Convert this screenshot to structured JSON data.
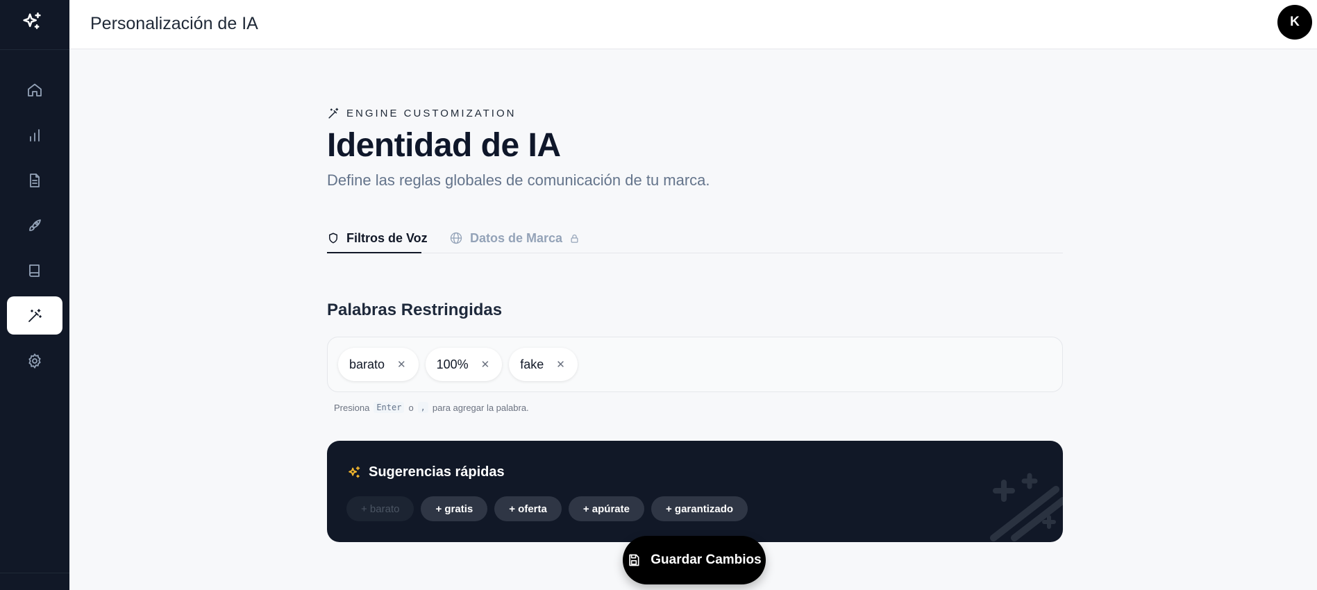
{
  "header": {
    "title": "Personalización de IA",
    "avatar_initial": "K"
  },
  "sidebar": {
    "items": [
      {
        "icon": "home-icon"
      },
      {
        "icon": "bar-chart-icon"
      },
      {
        "icon": "document-icon"
      },
      {
        "icon": "rocket-icon"
      },
      {
        "icon": "book-icon"
      },
      {
        "icon": "magic-wand-icon",
        "active": true
      },
      {
        "icon": "gear-icon"
      }
    ]
  },
  "main": {
    "eyebrow": "ENGINE CUSTOMIZATION",
    "title": "Identidad de IA",
    "subtitle": "Define las reglas globales de comunicación de tu marca.",
    "tabs": [
      {
        "label": "Filtros de Voz",
        "active": true
      },
      {
        "label": "Datos de Marca",
        "locked": true
      }
    ],
    "restricted": {
      "title": "Palabras Restringidas",
      "tags": [
        "barato",
        "100%",
        "fake"
      ],
      "hint_prefix": "Presiona",
      "hint_key1": "Enter",
      "hint_or": "o",
      "hint_key2": ",",
      "hint_suffix": "para agregar la palabra."
    },
    "suggestions": {
      "title": "Sugerencias rápidas",
      "chips": [
        {
          "label": "+ barato",
          "disabled": true
        },
        {
          "label": "+ gratis"
        },
        {
          "label": "+ oferta"
        },
        {
          "label": "+ apúrate"
        },
        {
          "label": "+ garantizado"
        }
      ]
    },
    "save_label": "Guardar Cambios"
  },
  "colors": {
    "accent": "#f5b82e",
    "sidebar_bg": "#111827",
    "primary": "#000000"
  }
}
